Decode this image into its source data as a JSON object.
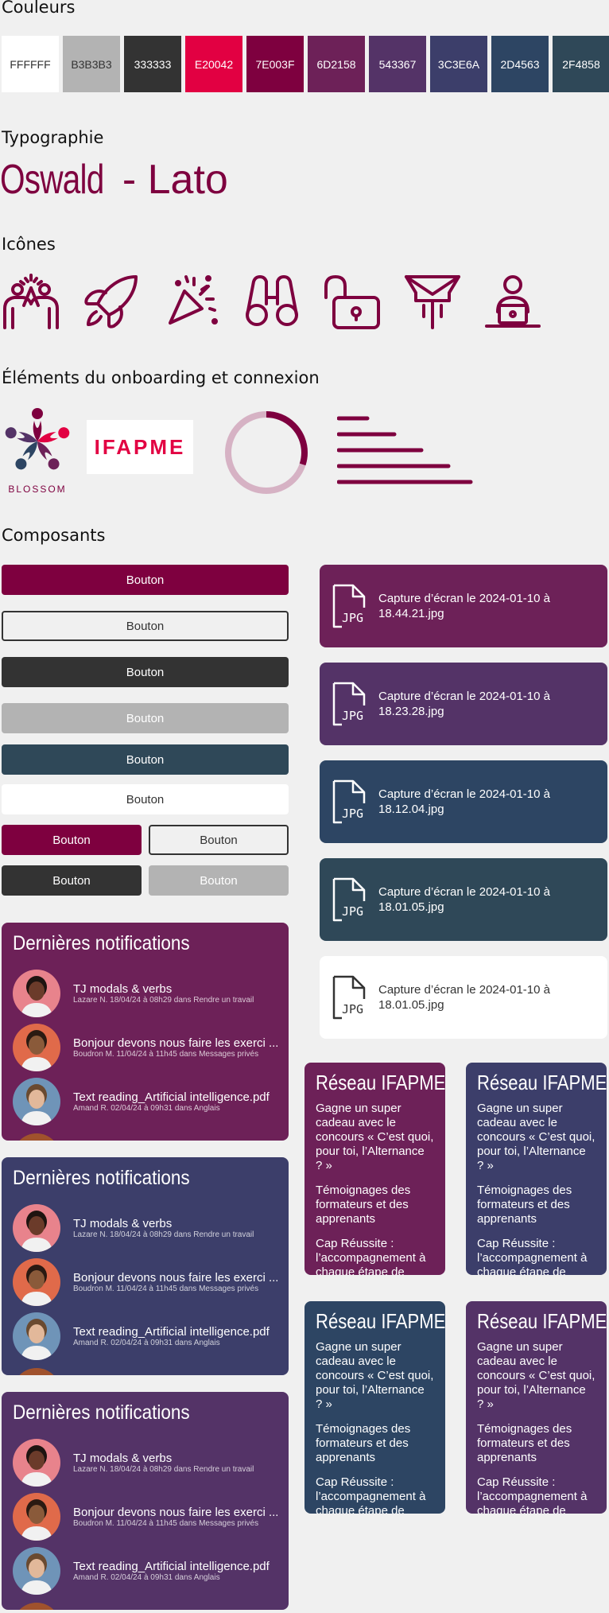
{
  "sections": {
    "colors": "Couleurs",
    "typography": "Typographie",
    "icons": "Icônes",
    "onboarding": "Éléments du onboarding et connexion",
    "components": "Composants"
  },
  "swatches": [
    {
      "label": "FFFFFF",
      "bg": "#FFFFFF",
      "fg": "#333333"
    },
    {
      "label": "B3B3B3",
      "bg": "#B3B3B3",
      "fg": "#333333"
    },
    {
      "label": "333333",
      "bg": "#333333",
      "fg": "#FFFFFF"
    },
    {
      "label": "E20042",
      "bg": "#E20042",
      "fg": "#FFFFFF"
    },
    {
      "label": "7E003F",
      "bg": "#7E003F",
      "fg": "#FFFFFF"
    },
    {
      "label": "6D2158",
      "bg": "#6D2158",
      "fg": "#FFFFFF"
    },
    {
      "label": "543367",
      "bg": "#543367",
      "fg": "#FFFFFF"
    },
    {
      "label": "3C3E6A",
      "bg": "#3C3E6A",
      "fg": "#FFFFFF"
    },
    {
      "label": "2D4563",
      "bg": "#2D4563",
      "fg": "#FFFFFF"
    },
    {
      "label": "2F4858",
      "bg": "#2F4858",
      "fg": "#FFFFFF"
    }
  ],
  "typography": {
    "primary": "Oswald",
    "separator": " - ",
    "secondary": "Lato"
  },
  "icons": [
    "team-celebration-icon",
    "rocket-icon",
    "celebration-icon",
    "binoculars-icon",
    "unlocked-padlock-icon",
    "mail-rocket-icon",
    "person-laptop-icon"
  ],
  "onboarding": {
    "blossom_label": "BLOSSOM",
    "ifapme_label": "IFAPME",
    "progress": 0.3
  },
  "buttons": {
    "label": "Bouton"
  },
  "files": [
    {
      "name": "Capture d’écran le 2024-01-10 à 18.44.21.jpg",
      "badge": "JPG",
      "bg": "#6D2158"
    },
    {
      "name": "Capture d’écran le 2024-01-10 à 18.23.28.jpg",
      "badge": "JPG",
      "bg": "#543367"
    },
    {
      "name": "Capture d’écran le 2024-01-10 à 18.12.04.jpg",
      "badge": "JPG",
      "bg": "#2D4563"
    },
    {
      "name": "Capture d’écran le 2024-01-10 à 18.01.05.jpg",
      "badge": "JPG",
      "bg": "#2F4858"
    },
    {
      "name": "Capture d’écran le 2024-01-10 à 18.01.05.jpg",
      "badge": "JPG",
      "bg": "#FFFFFF"
    }
  ],
  "notifications": {
    "title": "Dernières notifications",
    "items": [
      {
        "title": "TJ modals & verbs",
        "meta": "Lazare N. 18/04/24 à 08h29 dans Rendre un travail"
      },
      {
        "title": "Bonjour devons nous faire les exerci ...",
        "meta": "Boudron M. 11/04/24 à 11h45 dans Messages privés"
      },
      {
        "title": "Text reading_Artificial intelligence.pdf",
        "meta": "Amand R. 02/04/24 à 09h31 dans Anglais"
      }
    ]
  },
  "cards": {
    "title": "Réseau IFAPME",
    "items": [
      "Gagne un super cadeau avec le concours « C’est quoi, pour toi, l’Alternance ? »",
      "Témoignages des formateurs et des apprenants",
      "Cap Réussite : l’accompagnement à chaque étape de"
    ]
  }
}
